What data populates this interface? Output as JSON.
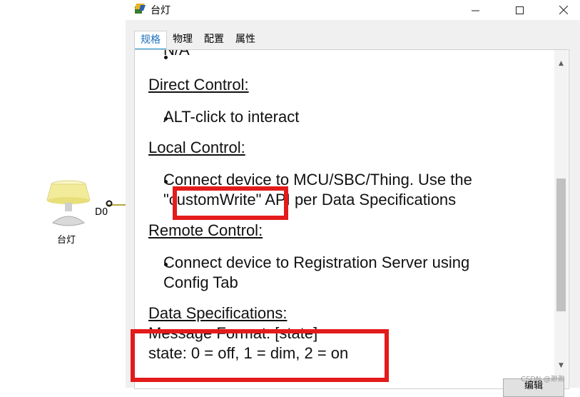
{
  "workspace": {
    "device_label": "台灯",
    "port_label": "D0"
  },
  "window": {
    "title": "台灯",
    "controls": {
      "minimize": "—",
      "maximize": "☐",
      "close": "✕"
    }
  },
  "tabs": [
    {
      "label": "规格",
      "active": true
    },
    {
      "label": "物理",
      "active": false
    },
    {
      "label": "配置",
      "active": false
    },
    {
      "label": "属性",
      "active": false
    }
  ],
  "spec": {
    "top_partial": "N/A",
    "direct_heading": "Direct Control:",
    "direct_item": "ALT-click to interact",
    "local_heading": "Local Control:",
    "local_item_line1": "Connect device to MCU/SBC/Thing. Use the",
    "local_item_line2_a": "\"customWrite\"",
    "local_item_line2_b": " API per Data Specifications",
    "remote_heading": "Remote Control:",
    "remote_item_line1": "Connect device to Registration Server using",
    "remote_item_line2": "Config Tab",
    "data_heading": "Data Specifications:",
    "message_format": "Message Format: [state]",
    "state_line": "state: 0 = off, 1 = dim, 2 = on"
  },
  "footer": {
    "edit_button": "编辑",
    "watermark": "CSDN @渺渺"
  },
  "colors": {
    "highlight": "#e31b1b",
    "active_tab": "#1b6fbf",
    "lamp_shade": "#f2ec9a"
  }
}
